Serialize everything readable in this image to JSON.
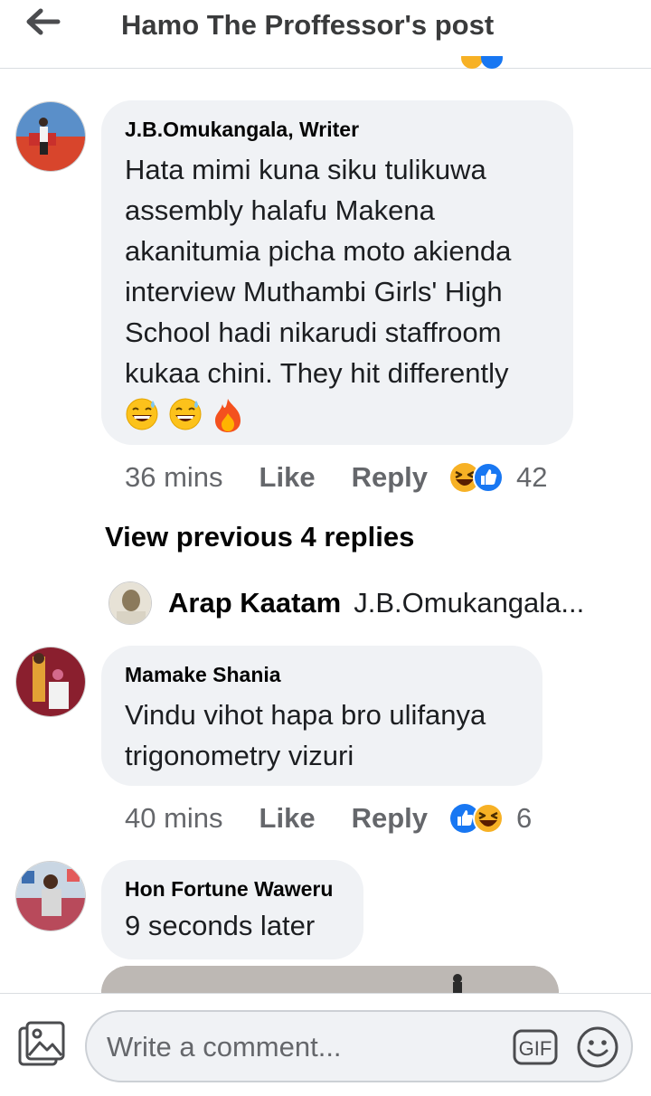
{
  "header": {
    "title": "Hamo The Proffessor's post",
    "back_icon": "back-arrow-icon"
  },
  "comments": [
    {
      "author": "J.B.Omukangala, Writer",
      "lines": [
        "Hata mimi kuna siku tulikuwa",
        "assembly halafu Makena",
        "akanitumia picha moto akienda",
        "interview Muthambi Girls' High",
        "School hadi nikarudi staffroom",
        "kukaa chini. They hit differently"
      ],
      "emojis": [
        "grinning-sweat-emoji",
        "grinning-sweat-emoji",
        "fire-emoji"
      ],
      "time": "36 mins",
      "like_label": "Like",
      "reply_label": "Reply",
      "reaction_count": "42"
    },
    {
      "author": "Mamake Shania",
      "lines": [
        "Vindu vihot hapa bro ulifanya",
        "trigonometry vizuri"
      ],
      "time": "40 mins",
      "like_label": "Like",
      "reply_label": "Reply",
      "reaction_count": "6"
    },
    {
      "author": "Hon Fortune Waweru",
      "lines": [
        "9 seconds later"
      ]
    }
  ],
  "view_previous": "View previous 4 replies",
  "reply_preview": {
    "author": "Arap Kaatam",
    "snippet": "J.B.Omukangala..."
  },
  "composer": {
    "placeholder": "Write a comment...",
    "gif_label": "GIF"
  },
  "colors": {
    "bubble": "#f0f2f5",
    "meta": "#65676b",
    "like_blue": "#1877f2",
    "haha_yellow": "#f7b125"
  }
}
